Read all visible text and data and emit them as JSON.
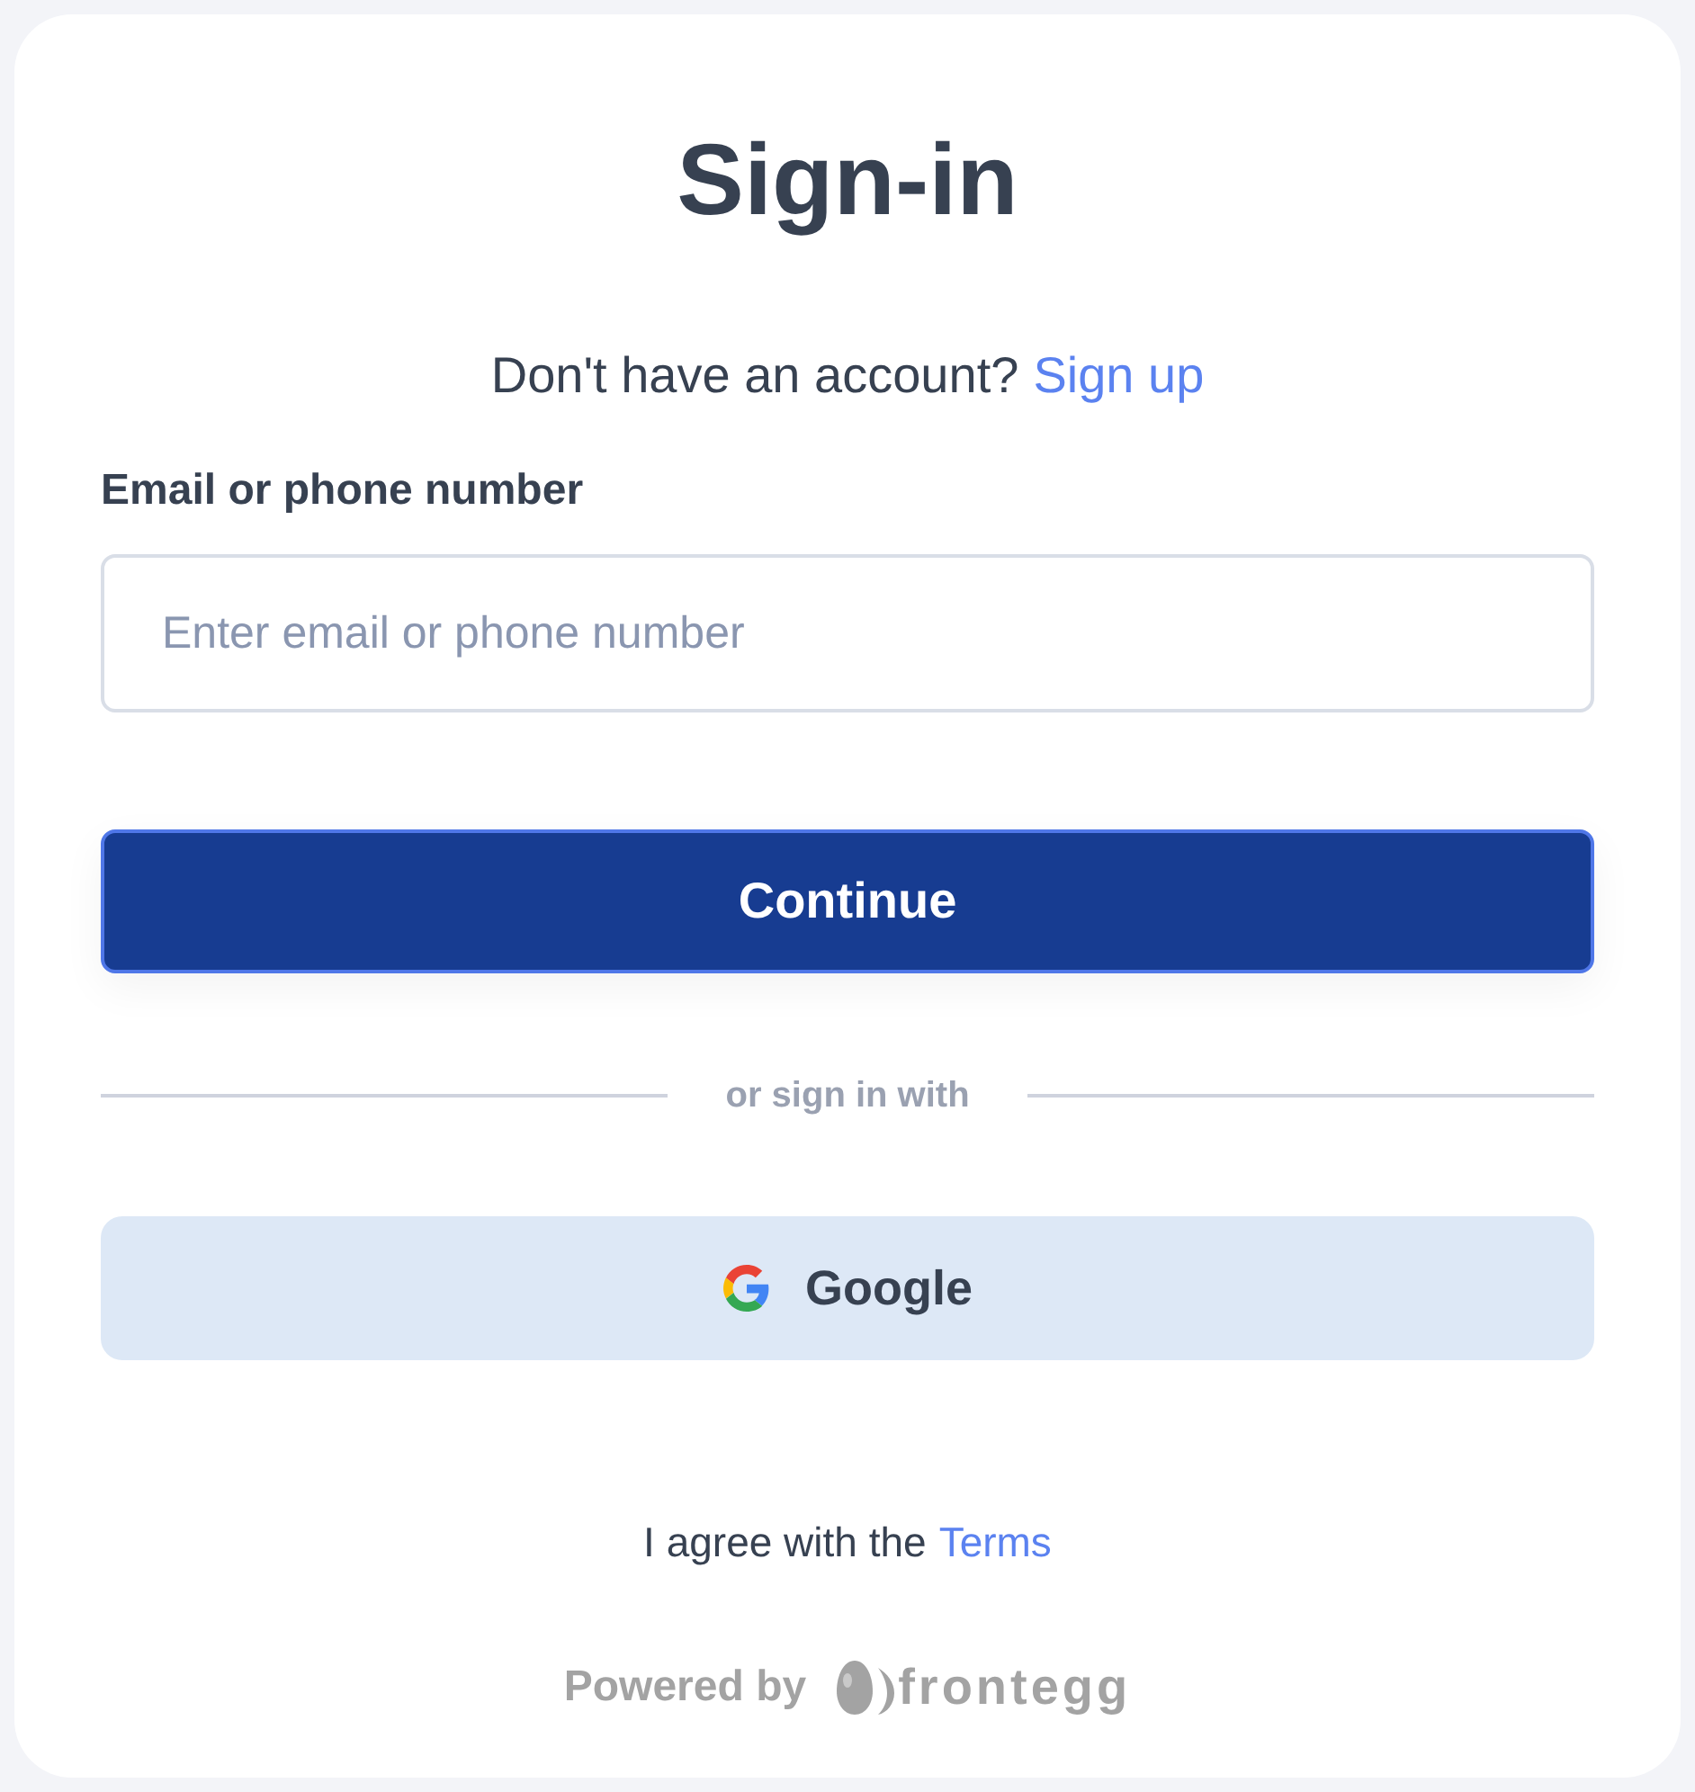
{
  "title": "Sign-in",
  "signup_prompt": {
    "text": "Don't have an account?",
    "link": "Sign up"
  },
  "email_field": {
    "label": "Email or phone number",
    "placeholder": "Enter email or phone number"
  },
  "continue_button": "Continue",
  "divider": "or sign in with",
  "social_buttons": [
    {
      "kind": "google",
      "label": "Google"
    }
  ],
  "terms": {
    "text": "I agree with the",
    "link": "Terms"
  },
  "footer": {
    "text": "Powered by",
    "brand": "frontegg"
  }
}
